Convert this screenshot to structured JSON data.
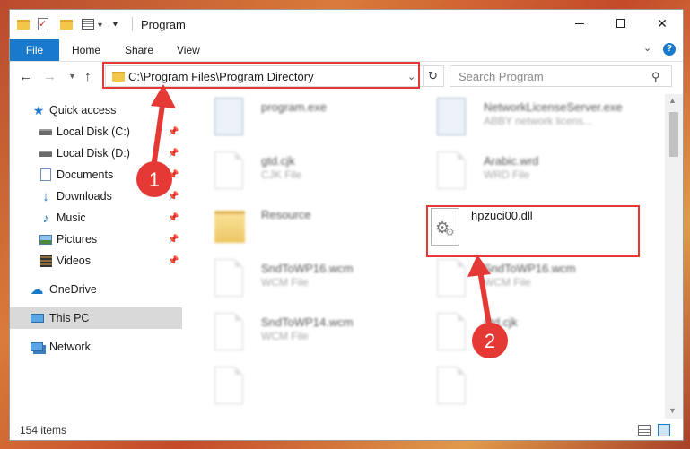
{
  "window": {
    "title": "Program"
  },
  "ribbon": {
    "file": "File",
    "home": "Home",
    "share": "Share",
    "view": "View",
    "help": "?"
  },
  "nav": {
    "address": "C:\\Program Files\\Program Directory",
    "search_placeholder": "Search Program"
  },
  "sidebar": {
    "items": [
      {
        "label": "Quick access",
        "icon": "star-icon",
        "pinned": false
      },
      {
        "label": "Local Disk (C:)",
        "icon": "drive-icon",
        "pinned": true
      },
      {
        "label": "Local Disk (D:)",
        "icon": "drive-icon",
        "pinned": true
      },
      {
        "label": "Documents",
        "icon": "documents-icon",
        "pinned": true
      },
      {
        "label": "Downloads",
        "icon": "download-icon",
        "pinned": true
      },
      {
        "label": "Music",
        "icon": "music-icon",
        "pinned": true
      },
      {
        "label": "Pictures",
        "icon": "pictures-icon",
        "pinned": true
      },
      {
        "label": "Videos",
        "icon": "videos-icon",
        "pinned": true
      },
      {
        "label": "OneDrive",
        "icon": "cloud-icon",
        "pinned": false
      },
      {
        "label": "This PC",
        "icon": "computer-icon",
        "pinned": false,
        "selected": true
      },
      {
        "label": "Network",
        "icon": "network-icon",
        "pinned": false
      }
    ]
  },
  "files": [
    {
      "name": "program.exe",
      "type": "",
      "icon": "exe-icon",
      "blurred": true
    },
    {
      "name": "NetworkLicenseServer.exe",
      "type": "ABBY network licens...",
      "icon": "exe-icon",
      "blurred": true
    },
    {
      "name": "gtd.cjk",
      "type": "CJK File",
      "icon": "file-icon",
      "blurred": true
    },
    {
      "name": "Arabic.wrd",
      "type": "WRD File",
      "icon": "file-icon",
      "blurred": true
    },
    {
      "name": "Resource",
      "type": "",
      "icon": "folder-icon",
      "blurred": true
    },
    {
      "name": "hpzuci00.dll",
      "type": "",
      "icon": "dll-gear-icon",
      "blurred": false
    },
    {
      "name": "SndToWP16.wcm",
      "type": "WCM File",
      "icon": "file-icon",
      "blurred": true
    },
    {
      "name": "SndToWP16.wcm",
      "type": "WCM File",
      "icon": "file-icon",
      "blurred": true
    },
    {
      "name": "SndToWP14.wcm",
      "type": "WCM File",
      "icon": "file-icon",
      "blurred": true
    },
    {
      "name": "gtd.cjk",
      "type": "",
      "icon": "file-icon",
      "blurred": true
    }
  ],
  "status": {
    "count": "154 items"
  },
  "annotations": {
    "step1": "1",
    "step2": "2",
    "color": "#e53935"
  }
}
